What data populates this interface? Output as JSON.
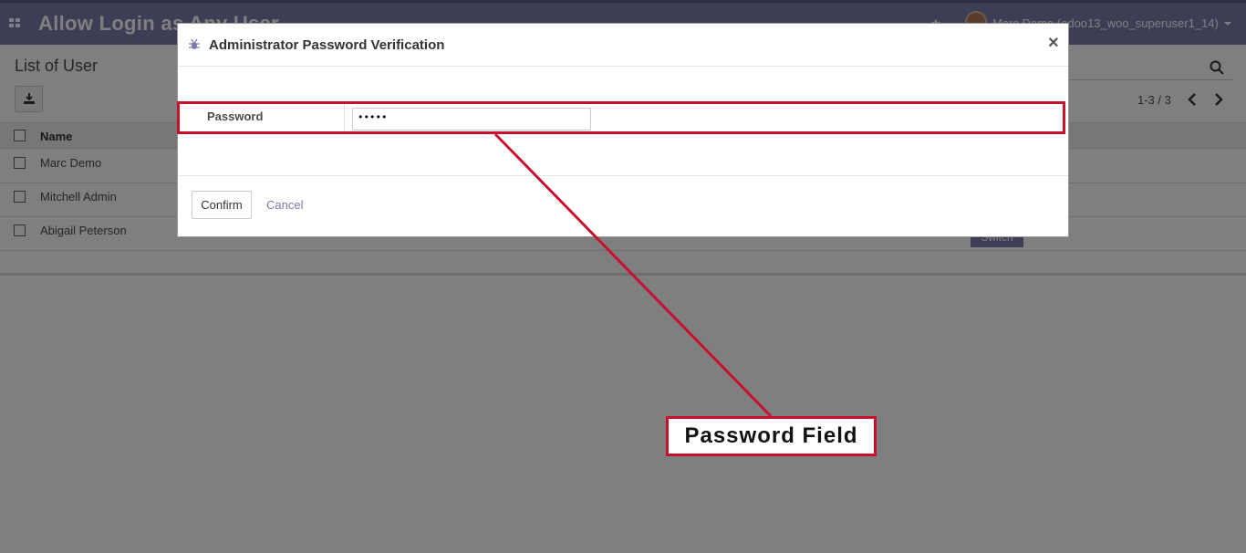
{
  "navbar": {
    "app_title": "Allow Login as Any User",
    "user_label": "Marc Demo (odoo13_woo_superuser1_14)",
    "color": "#7c7bad"
  },
  "control_panel": {
    "title": "List of User",
    "pager": "1-3 / 3"
  },
  "list": {
    "column_name": "Name",
    "rows": [
      {
        "name": "Marc Demo"
      },
      {
        "name": "Mitchell Admin"
      },
      {
        "name": "Abigail Peterson"
      }
    ],
    "switch_label": "Switch"
  },
  "modal": {
    "title": "Administrator Password Verification",
    "close": "×",
    "field_label": "Password",
    "password_value": "•••••",
    "confirm_label": "Confirm",
    "cancel_label": "Cancel"
  },
  "annotation": {
    "label": "Password Field",
    "color": "#c8102e"
  }
}
